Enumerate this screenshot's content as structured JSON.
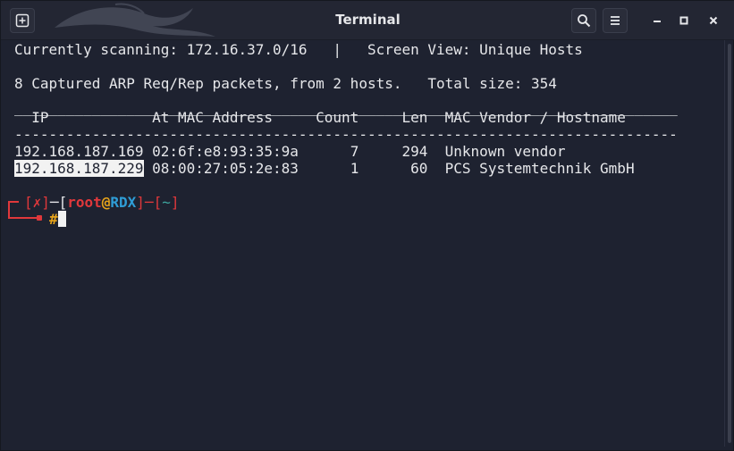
{
  "window": {
    "title": "Terminal"
  },
  "icons": {
    "new_tab": "new-tab-icon",
    "search": "search-icon",
    "menu": "hamburger-menu-icon",
    "minimize": "minimize-icon",
    "maximize": "maximize-icon",
    "close": "close-icon"
  },
  "terminal": {
    "status_line": "Currently scanning: 172.16.37.0/16   |   Screen View: Unique Hosts",
    "summary_line": "8 Captured ARP Req/Rep packets, from 2 hosts.   Total size: 354",
    "rule_top": "_____________________________________________________________________________",
    "header_line": "  IP            At MAC Address     Count     Len  MAC Vendor / Hostname",
    "rule_dashes": "-----------------------------------------------------------------------------",
    "hosts": [
      {
        "ip": "192.168.187.169",
        "rest": " 02:6f:e8:93:35:9a      7     294  Unknown vendor"
      },
      {
        "ip": "192.168.187.229",
        "rest": " 08:00:27:05:2e:83      1      60  PCS Systemtechnik GmbH"
      }
    ],
    "prompt": {
      "status": "✗",
      "user": "root",
      "at": "@",
      "host": "RDX",
      "dir": "~",
      "symbol": "#"
    }
  },
  "colors": {
    "background": "#1e2230",
    "foreground": "#e6e7ea",
    "prompt_red": "#e0383b",
    "prompt_orange": "#e6a31a",
    "prompt_blue": "#2f9dd6",
    "prompt_teal": "#3fa7a0"
  }
}
